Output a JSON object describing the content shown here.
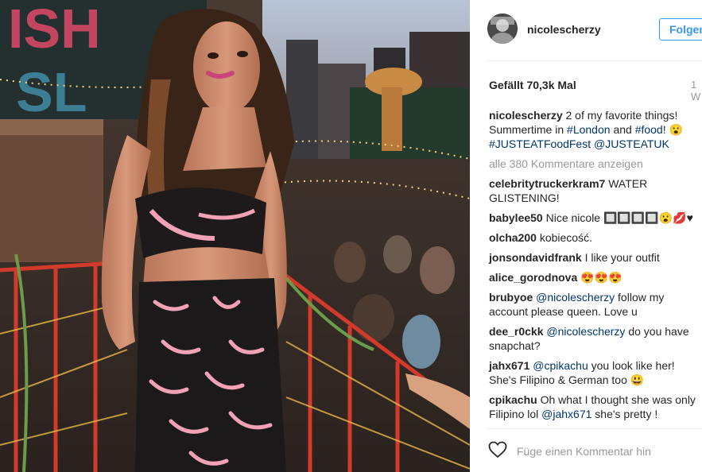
{
  "post": {
    "username": "nicolescherzy",
    "follow_label": "Folgen",
    "likes": "Gefällt 70,3k Mal",
    "time_ago": "1 W",
    "caption": {
      "user": "nicolescherzy",
      "text_1": "2 of my favorite things! Summertime in",
      "tag_london": "#London",
      "text_2": "and",
      "tag_food": "#food",
      "text_3": "! 😮",
      "tag_justeat": "#JUSTEATFoodFest",
      "mention_justeatuk": "@JUSTEATUK"
    },
    "load_more": "alle 380 Kommentare anzeigen",
    "comments": [
      {
        "user": "celebritytruckerkram7",
        "text": "WATER GLISTENING!"
      },
      {
        "user": "babylee50",
        "text": "Nice nicole 🔲🔲🔲🔲😮💋♥"
      },
      {
        "user": "olcha200",
        "text": "kobiecość."
      },
      {
        "user": "jonsondavidfrank",
        "text": "I like your outfit"
      },
      {
        "user": "alice_gorodnova",
        "text": "😍😍😍"
      },
      {
        "user": "brubyoe",
        "mention": "@nicolescherzy",
        "text": "follow my account please queen. Love u"
      },
      {
        "user": "dee_r0ckk",
        "mention": "@nicolescherzy",
        "text": "do you have snapchat?"
      },
      {
        "user": "jahx671",
        "mention": "@cpikachu",
        "text": "you look like her! She's Filipino & German too 😃"
      },
      {
        "user": "cpikachu",
        "text_before": "Oh what I thought she was only Filipino lol",
        "mention": "@jahx671",
        "text_after": "she's pretty !"
      }
    ],
    "comment_placeholder": "Füge einen Kommentar hin",
    "icons": {
      "like": "heart-outline-icon",
      "avatar": "profile-avatar"
    }
  }
}
